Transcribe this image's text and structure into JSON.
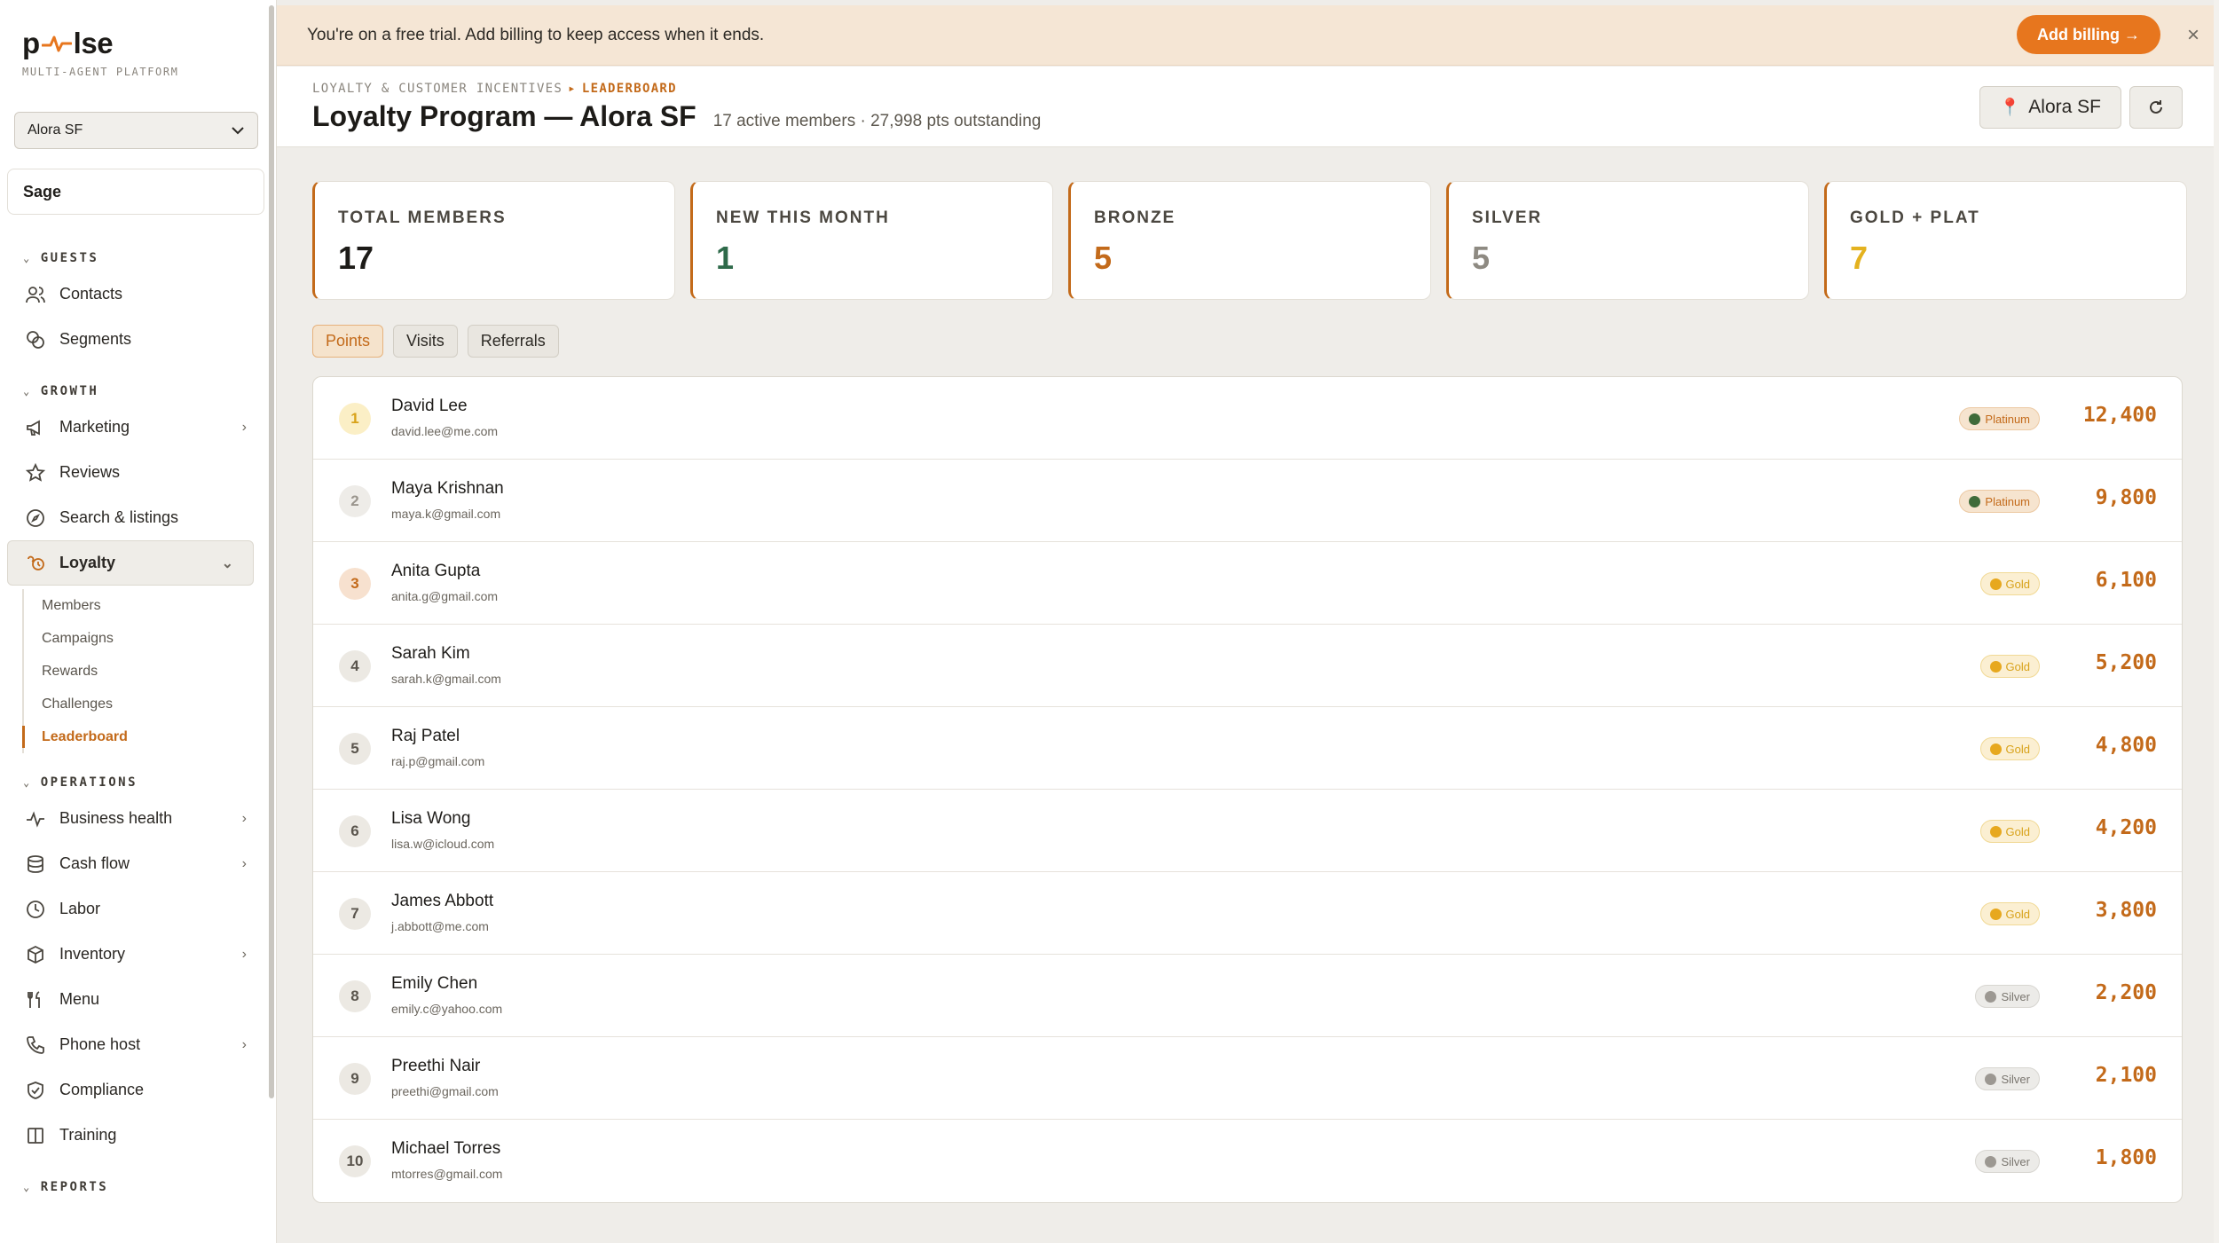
{
  "brand": {
    "logo_left": "p",
    "logo_right": "lse",
    "tagline": "MULTI-AGENT PLATFORM"
  },
  "sidebar": {
    "location_select": "Alora SF",
    "sage_label": "Sage",
    "sections": {
      "guests": "GUESTS",
      "growth": "GROWTH",
      "operations": "OPERATIONS",
      "reports": "REPORTS"
    },
    "guests_items": [
      {
        "label": "Contacts",
        "icon": "contacts-icon"
      },
      {
        "label": "Segments",
        "icon": "segments-icon"
      }
    ],
    "growth_items": [
      {
        "label": "Marketing",
        "icon": "megaphone-icon"
      },
      {
        "label": "Reviews",
        "icon": "star-icon"
      },
      {
        "label": "Search & listings",
        "icon": "compass-icon"
      },
      {
        "label": "Loyalty",
        "icon": "loyalty-icon"
      }
    ],
    "loyalty_sub": [
      "Members",
      "Campaigns",
      "Rewards",
      "Challenges",
      "Leaderboard"
    ],
    "operations_items": [
      {
        "label": "Business health",
        "icon": "pulse-icon"
      },
      {
        "label": "Cash flow",
        "icon": "database-icon"
      },
      {
        "label": "Labor",
        "icon": "clock-icon"
      },
      {
        "label": "Inventory",
        "icon": "box-icon"
      },
      {
        "label": "Menu",
        "icon": "utensils-icon"
      },
      {
        "label": "Phone host",
        "icon": "phone-icon"
      },
      {
        "label": "Compliance",
        "icon": "shield-icon"
      },
      {
        "label": "Training",
        "icon": "book-icon"
      }
    ]
  },
  "banner": {
    "text": "You're on a free trial. Add billing to keep access when it ends.",
    "button": "Add billing →",
    "close": "×"
  },
  "header": {
    "crumb_parent": "LOYALTY & CUSTOMER INCENTIVES",
    "crumb_sep": "▸",
    "crumb_current": "LEADERBOARD",
    "title": "Loyalty Program — Alora SF",
    "subtitle": "17 active members · 27,998 pts outstanding",
    "location_chip": "Alora SF"
  },
  "stats": [
    {
      "label": "TOTAL MEMBERS",
      "value": "17",
      "color": "#1d1b18"
    },
    {
      "label": "NEW THIS MONTH",
      "value": "1",
      "color": "#2e6a4a"
    },
    {
      "label": "BRONZE",
      "value": "5",
      "color": "#c36a1a"
    },
    {
      "label": "SILVER",
      "value": "5",
      "color": "#8e8a82"
    },
    {
      "label": "GOLD + PLAT",
      "value": "7",
      "color": "#e4b21f"
    }
  ],
  "tabs": [
    "Points",
    "Visits",
    "Referrals"
  ],
  "colors": {
    "accent": "#c36a1a",
    "billing": "#e7761e",
    "platinum_bg": "#f6e4cf",
    "gold_bg": "#fbefd2",
    "silver_bg": "#ecebe8"
  },
  "leaderboard": [
    {
      "rank": "1",
      "name": "David Lee",
      "email": "david.lee@me.com",
      "tier": "Platinum",
      "points": "12,400"
    },
    {
      "rank": "2",
      "name": "Maya Krishnan",
      "email": "maya.k@gmail.com",
      "tier": "Platinum",
      "points": "9,800"
    },
    {
      "rank": "3",
      "name": "Anita Gupta",
      "email": "anita.g@gmail.com",
      "tier": "Gold",
      "points": "6,100"
    },
    {
      "rank": "4",
      "name": "Sarah Kim",
      "email": "sarah.k@gmail.com",
      "tier": "Gold",
      "points": "5,200"
    },
    {
      "rank": "5",
      "name": "Raj Patel",
      "email": "raj.p@gmail.com",
      "tier": "Gold",
      "points": "4,800"
    },
    {
      "rank": "6",
      "name": "Lisa Wong",
      "email": "lisa.w@icloud.com",
      "tier": "Gold",
      "points": "4,200"
    },
    {
      "rank": "7",
      "name": "James Abbott",
      "email": "j.abbott@me.com",
      "tier": "Gold",
      "points": "3,800"
    },
    {
      "rank": "8",
      "name": "Emily Chen",
      "email": "emily.c@yahoo.com",
      "tier": "Silver",
      "points": "2,200"
    },
    {
      "rank": "9",
      "name": "Preethi Nair",
      "email": "preethi@gmail.com",
      "tier": "Silver",
      "points": "2,100"
    },
    {
      "rank": "10",
      "name": "Michael Torres",
      "email": "mtorres@gmail.com",
      "tier": "Silver",
      "points": "1,800"
    }
  ]
}
